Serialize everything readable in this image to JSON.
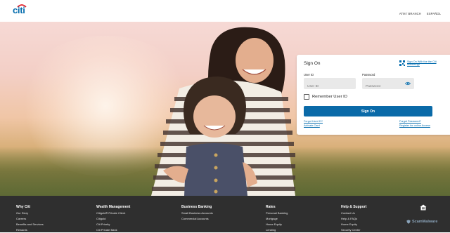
{
  "brand": {
    "logo_text": "citi"
  },
  "top_links": [
    "ATM / BRANCH",
    "ESPAÑOL"
  ],
  "signin": {
    "title": "Sign On",
    "mobile_link": "Sign On With the the Citi MobileApp",
    "user_id_label": "User ID",
    "user_id_placeholder": "User ID",
    "password_label": "Password",
    "password_placeholder": "Password",
    "remember_label": "Remember User ID",
    "button": "Sign On",
    "forgot_user_id": "Forgot User ID?",
    "activate_card": "Activate Card",
    "forgot_password": "Forgot Password?",
    "register": "Register for online Access"
  },
  "footer": {
    "columns": [
      {
        "heading": "Why Citi",
        "items": [
          "Our Story",
          "Careers",
          "Benefits and Services",
          "Rewards"
        ]
      },
      {
        "heading": "Wealth Management",
        "items": [
          "Citigold® Private Client",
          "Citigold",
          "Citi Priority",
          "Citi Private Bank"
        ]
      },
      {
        "heading": "Business Banking",
        "items": [
          "Small Business Accounts",
          "Commercial Accounts"
        ]
      },
      {
        "heading": "Rates",
        "items": [
          "Personal Banking",
          "Mortgage",
          "Home Equity",
          "Lending"
        ]
      },
      {
        "heading": "Help & Support",
        "items": [
          "Contact Us",
          "Help & FAQs",
          "Home Equity",
          "Security Center"
        ]
      }
    ],
    "watermark": "ScamMalware"
  },
  "colors": {
    "brand_blue": "#056dae",
    "button_blue": "#0a6aa8",
    "footer_bg": "#2f2f2f"
  }
}
